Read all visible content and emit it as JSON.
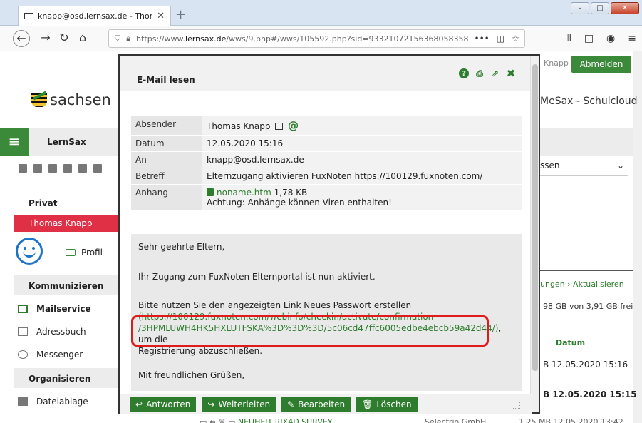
{
  "browser": {
    "tab_title": "knapp@osd.lernsax.de - Thom",
    "tab_close": "✕",
    "new_tab": "+",
    "url_prefix": "https://www.",
    "url_domain": "lernsax.de",
    "url_rest": "/wws/9.php#/wws/105592.php?sid=93321072156368058358",
    "url_more": "•••"
  },
  "header": {
    "logo_text": "sachsen",
    "user_short": "Knapp",
    "logout_label": "Abmelden",
    "site_title": "MeSax - Schulcloud"
  },
  "sidebar": {
    "top_label": "LernSax",
    "privat_label": "Privat",
    "user_name": "Thomas Knapp",
    "profil_label": "Profil",
    "section_communicate": "Kommunizieren",
    "item_mail": "Mailservice",
    "item_addressbook": "Adressbuch",
    "item_messenger": "Messenger",
    "section_organize": "Organisieren",
    "item_files": "Dateiablage"
  },
  "right_panel": {
    "select_value": "ssen",
    "links": "ungen  › Aktualisieren",
    "free_space": "98 GB von 3,91 GB frei",
    "col_datum": "Datum",
    "row1": "B   12.05.2020 15:16",
    "row2": "B   12.05.2020 15:15"
  },
  "modal": {
    "title": "E-Mail lesen",
    "fields": {
      "absender_label": "Absender",
      "absender_value": "Thomas Knapp",
      "datum_label": "Datum",
      "datum_value": "12.05.2020 15:16",
      "an_label": "An",
      "an_value": "knapp@osd.lernsax.de",
      "betreff_label": "Betreff",
      "betreff_value": "Elternzugang aktivieren FuxNoten https://100129.fuxnoten.com/",
      "anhang_label": "Anhang",
      "anhang_file": "noname.htm",
      "anhang_size": "1,78 KB",
      "anhang_warning": "Achtung: Anhänge können Viren enthalten!"
    },
    "body": {
      "greeting": "Sehr geehrte Eltern,",
      "line1": "Ihr Zugang zum FuxNoten Elternportal ist nun aktiviert.",
      "line2": "Bitte nutzen Sie den angezeigten Link Neues Passwort erstellen",
      "link1": "(https://100129.fuxnoten.com/webinfo/checkin/activate/confirmation",
      "link2": "/3HPMLUWH4HK5HXLUTFSKA%3D%3D%3D/5c06cd47ffc6005edbe4ebcb59a42d44/)",
      "after_link": ", um die",
      "line3": "Registrierung abzuschließen.",
      "closing": "Mit freundlichen Grüßen,"
    },
    "buttons": {
      "reply": "Antworten",
      "forward": "Weiterleiten",
      "edit": "Bearbeiten",
      "delete": "Löschen"
    }
  },
  "bottom_row": {
    "subject": "NEUHEIT RIX4D SURVEY",
    "sender": "Selectrio GmbH",
    "size_date": "1,25 MB  12.05.2020 13:42"
  }
}
